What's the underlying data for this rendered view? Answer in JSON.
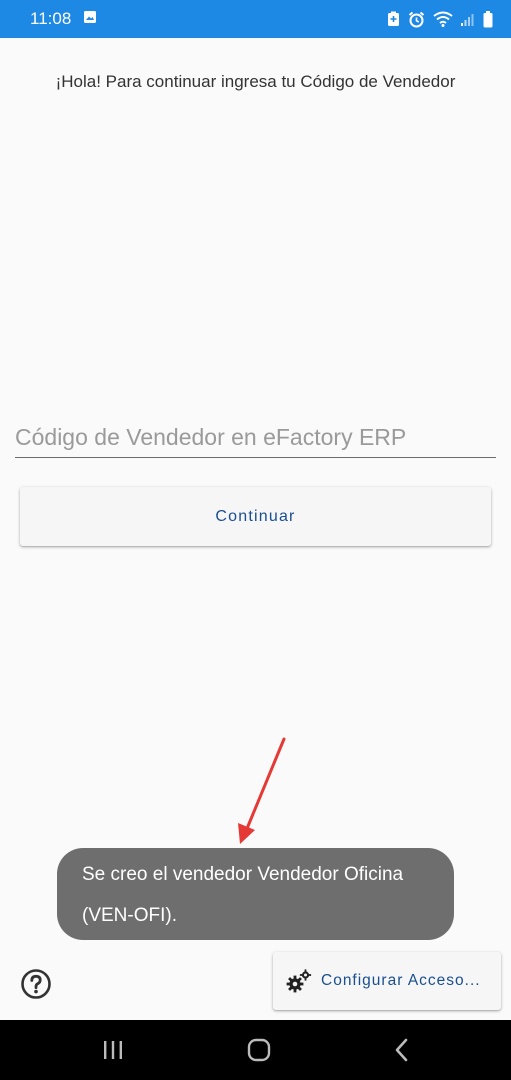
{
  "status_bar": {
    "time": "11:08",
    "icons": [
      "gallery-icon",
      "battery-saver-icon",
      "alarm-icon",
      "wifi-icon",
      "signal-icon",
      "battery-icon"
    ]
  },
  "greeting": "¡Hola! Para continuar ingresa tu Código de Vendedor",
  "vendor_input": {
    "placeholder": "Código de Vendedor en eFactory ERP",
    "value": ""
  },
  "continue_label": "Continuar",
  "toast": {
    "text": "Se creo el vendedor Vendedor Oficina (VEN-OFI)."
  },
  "help_icon": "question-circle-icon",
  "config_label": "Configurar Acceso...",
  "nav": {
    "icons": [
      "recent-apps-icon",
      "home-icon",
      "back-icon"
    ]
  },
  "colors": {
    "status_bar": "#1e88e5",
    "accent_text": "#1a4f8f",
    "toast_bg": "#6e6e6e",
    "arrow": "#e53935"
  }
}
